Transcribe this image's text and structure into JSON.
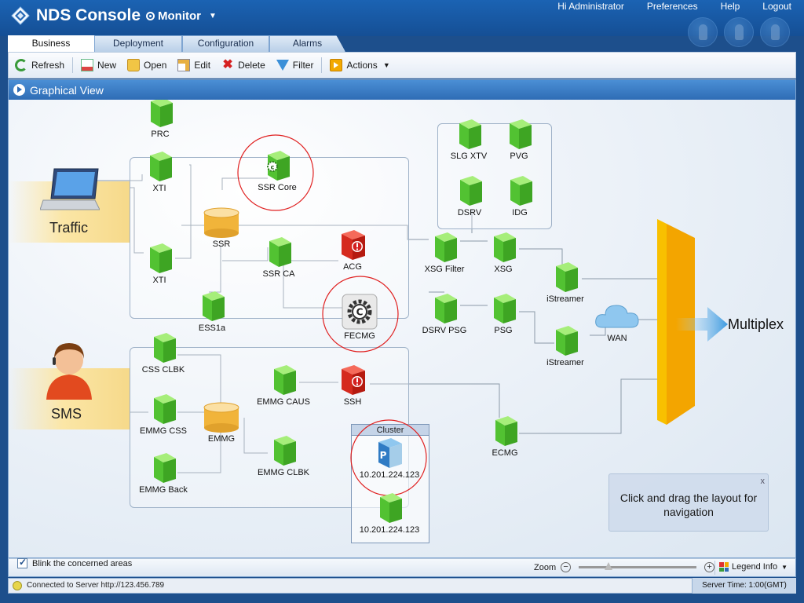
{
  "app": {
    "name": "NDS Console",
    "mode_label": "Monitor",
    "top_links": {
      "user": "Hi Administrator",
      "preferences": "Preferences",
      "help": "Help",
      "logout": "Logout"
    }
  },
  "tabs": [
    {
      "label": "Business",
      "active": true
    },
    {
      "label": "Deployment",
      "active": false
    },
    {
      "label": "Configuration",
      "active": false
    },
    {
      "label": "Alarms",
      "active": false
    }
  ],
  "toolbar": {
    "refresh": "Refresh",
    "new": "New",
    "open": "Open",
    "edit": "Edit",
    "delete": "Delete",
    "filter": "Filter",
    "actions": "Actions"
  },
  "panel": {
    "title": "Graphical View"
  },
  "roles": {
    "traffic": "Traffic",
    "sms": "SMS",
    "multiplex": "Multiplex"
  },
  "nodes": {
    "prc": "PRC",
    "xti_top": "XTI",
    "xti_bottom": "XTI",
    "ssr_core": "SSR Core",
    "ssr": "SSR",
    "ssr_ca": "SSR CA",
    "acg": "ACG",
    "ess1a": "ESS1a",
    "fecmg": "FECMG",
    "slg_xtv": "SLG XTV",
    "pvg": "PVG",
    "dsrv": "DSRV",
    "idg": "IDG",
    "xsg_filter": "XSG Filter",
    "xsg": "XSG",
    "dsrv_psg": "DSRV PSG",
    "psg": "PSG",
    "istreamer_top": "iStreamer",
    "istreamer_bottom": "iStreamer",
    "wan": "WAN",
    "css_clbk": "CSS CLBK",
    "emmg_caus": "EMMG CAUS",
    "ssh": "SSH",
    "emmg_css": "EMMG CSS",
    "emmg": "EMMG",
    "emmg_back": "EMMG Back",
    "emmg_clbk": "EMMG CLBK",
    "ecmg": "ECMG",
    "cluster_node_1": "10.201.224.123",
    "cluster_node_2": "10.201.224.123"
  },
  "cluster": {
    "title": "Cluster"
  },
  "hint": {
    "text": "Click and drag the layout for navigation",
    "close": "x"
  },
  "bottom": {
    "blink_label": "Blink the concerned areas",
    "blink_checked": true,
    "zoom_label": "Zoom",
    "zoom_minus": "−",
    "zoom_plus": "+",
    "zoom_level": 0.25,
    "legend_label": "Legend Info"
  },
  "status": {
    "connection": "Connected to Server http://123.456.789",
    "server_time": "Server Time: 1:00(GMT)"
  },
  "colors": {
    "accent_blue": "#2e6cb5",
    "node_green": "#5fcf3f",
    "alarm_red": "#d42020",
    "multiplex_orange": "#f2a900",
    "highlight_circle": "#e02020"
  }
}
